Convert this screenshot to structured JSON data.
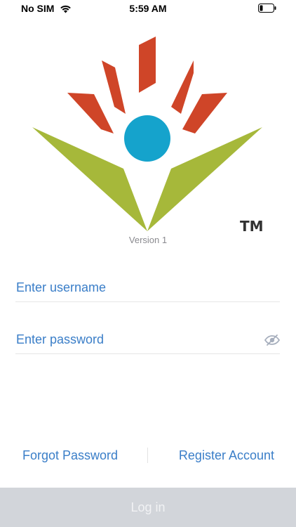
{
  "status_bar": {
    "carrier": "No SIM",
    "time": "5:59 AM"
  },
  "branding": {
    "trademark": "TM",
    "version": "Version 1",
    "colors": {
      "petals": "#cf4528",
      "leaves": "#a6b83a",
      "circle": "#15a3cc"
    }
  },
  "form": {
    "username_placeholder": "Enter username",
    "username_value": "",
    "password_placeholder": "Enter password",
    "password_value": ""
  },
  "links": {
    "forgot_password": "Forgot Password",
    "register_account": "Register Account"
  },
  "actions": {
    "login_label": "Log in"
  },
  "theme": {
    "accent": "#3a7ec8",
    "button_disabled": "#d2d5da"
  }
}
